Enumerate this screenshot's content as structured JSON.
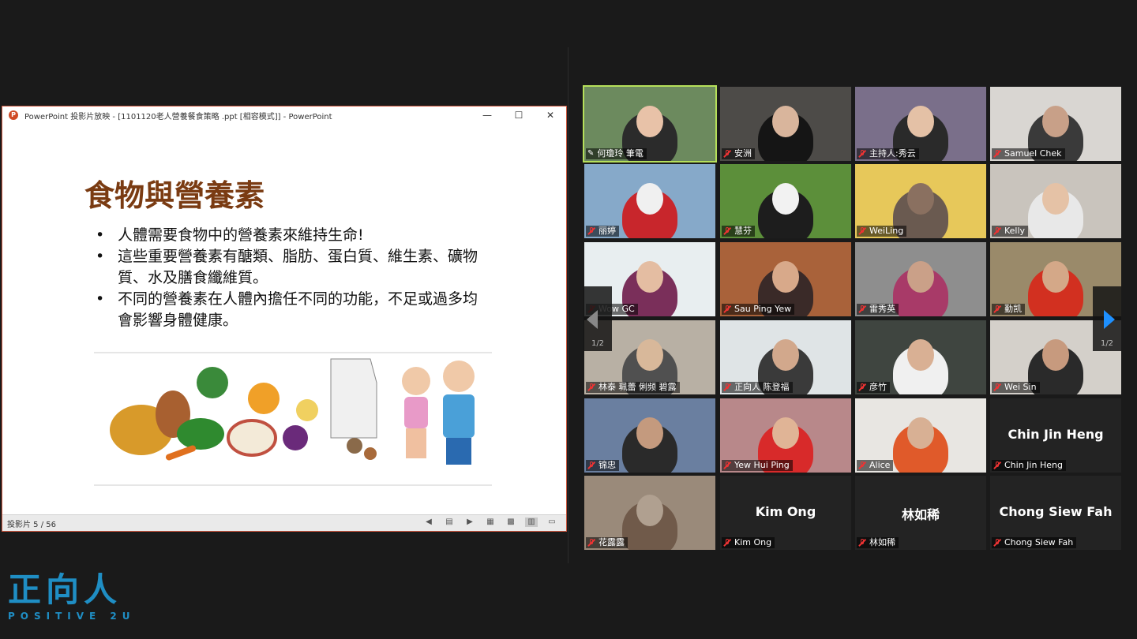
{
  "powerpoint": {
    "window_title": "PowerPoint 投影片放映 - [1101120老人營養餐食策略 .ppt [相容模式]] - PowerPoint",
    "controls": [
      "—",
      "☐",
      "✕"
    ],
    "slide": {
      "title": "食物與營養素",
      "bullets": [
        "人體需要食物中的營養素來維持生命!",
        "這些重要營養素有醣類、脂肪、蛋白質、維生素、礦物質、水及膳食纖維質。",
        "不同的營養素在人體內擔任不同的功能，不足或過多均會影響身體健康。"
      ]
    },
    "status": {
      "slide_count": "投影片 5 / 56"
    }
  },
  "brand": {
    "cn": "正向人",
    "en": "POSITIVE 2U"
  },
  "gallery": {
    "page_left": "1/2",
    "page_right": "1/2",
    "tiles": [
      {
        "name": "何瓊玲 筆電",
        "bg": "#6c8a5e",
        "skin": "#e8c2a8",
        "shirt": "#2b2b2b"
      },
      {
        "name": "安洲",
        "bg": "#4d4b48",
        "skin": "#d9b59c",
        "shirt": "#151515"
      },
      {
        "name": "主持人:秀云",
        "bg": "#7a6f8a",
        "skin": "#e4c1a6",
        "shirt": "#2a2a2a"
      },
      {
        "name": "Samuel Chek",
        "bg": "#d9d6d2",
        "skin": "#c8a088",
        "shirt": "#3a3a3a"
      },
      {
        "name": "丽婷",
        "bg": "#86a9c9",
        "skin": "#f0f0f0",
        "shirt": "#c8262c"
      },
      {
        "name": "慧芬",
        "bg": "#5c8f3a",
        "skin": "#f2f2f2",
        "shirt": "#1d1d1d"
      },
      {
        "name": "WeiLing",
        "bg": "#e7c85a",
        "skin": "#8a7060",
        "shirt": "#6a5a50"
      },
      {
        "name": "Kelly",
        "bg": "#c9c4bd",
        "skin": "#e5c2a6",
        "shirt": "#e8e8e8"
      },
      {
        "name": "Wow GC",
        "bg": "#e8eef0",
        "skin": "#e4bda2",
        "shirt": "#7a2f5a"
      },
      {
        "name": "Sau Ping Yew",
        "bg": "#a9623a",
        "skin": "#d8a98a",
        "shirt": "#3a2a28"
      },
      {
        "name": "雷秀英",
        "bg": "#8e8e8e",
        "skin": "#caa088",
        "shirt": "#a83a68"
      },
      {
        "name": "勤凯",
        "bg": "#9a8a6a",
        "skin": "#d4a888",
        "shirt": "#d23020"
      },
      {
        "name": "林泰 珮蕾 俐频 碧露",
        "bg": "#b8b0a4",
        "skin": "#d8b89a",
        "shirt": "#505050"
      },
      {
        "name": "正向人  陈登福",
        "bg": "#dfe4e6",
        "skin": "#d2a88c",
        "shirt": "#3a3a3a"
      },
      {
        "name": "彦竹",
        "bg": "#3f4540",
        "skin": "#d9b094",
        "shirt": "#f0f0f0"
      },
      {
        "name": "Wei Sin",
        "bg": "#d4d0ca",
        "skin": "#c79a7e",
        "shirt": "#2a2a2a"
      },
      {
        "name": "锦忠",
        "bg": "#6a7fa0",
        "skin": "#c49a7e",
        "shirt": "#2a2a2a"
      },
      {
        "name": "Yew Hui Ping",
        "bg": "#b8888a",
        "skin": "#e0b496",
        "shirt": "#d82a2a"
      },
      {
        "name": "Alice",
        "bg": "#e8e6e2",
        "skin": "#d8b094",
        "shirt": "#e05a2a"
      },
      {
        "name": "Chin Jin Heng",
        "center": "Chin Jin Heng"
      },
      {
        "name": "花露露",
        "bg": "#9a8a7a",
        "skin": "#b0a090",
        "shirt": "#705a4a"
      },
      {
        "name": "Kim Ong",
        "center": "Kim Ong"
      },
      {
        "name": "林如稀",
        "center": "林如稀"
      },
      {
        "name": "Chong Siew Fah",
        "center": "Chong Siew Fah"
      }
    ]
  }
}
